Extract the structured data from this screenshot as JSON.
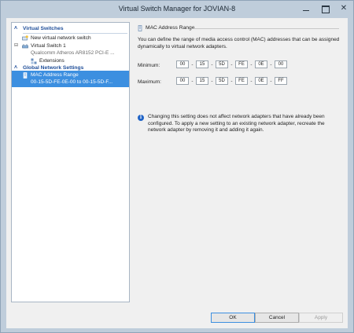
{
  "window": {
    "title": "Virtual Switch Manager for JOVIAN-8",
    "minimize_glyph": "",
    "maximize_glyph": "",
    "close_glyph": "✕"
  },
  "tree": {
    "virtual_switches": {
      "header": "Virtual Switches",
      "items": [
        {
          "label": "New virtual network switch",
          "icon": "new-switch-icon"
        },
        {
          "label": "Virtual Switch 1",
          "sublabel": "Qualcomm Atheros AR8152 PCI-E ...",
          "icon": "network-switch-icon"
        },
        {
          "label": "Extensions",
          "icon": "extensions-icon"
        }
      ]
    },
    "global_network_settings": {
      "header": "Global Network Settings",
      "items": [
        {
          "label": "MAC Address Range",
          "sublabel": "00-15-5D-FE-0E-00 to 00-15-5D-F...",
          "icon": "mac-range-icon",
          "selected": true
        }
      ]
    }
  },
  "detail": {
    "group_title": "MAC Address Range",
    "description": "You can define the range of media access control (MAC) addresses that can be assigned dynamically to virtual network adapters.",
    "minimum": {
      "label": "Minimum:",
      "octets": [
        "00",
        "15",
        "5D",
        "FE",
        "0E",
        "00"
      ]
    },
    "maximum": {
      "label": "Maximum:",
      "octets": [
        "00",
        "15",
        "5D",
        "FE",
        "0E",
        "FF"
      ]
    },
    "info_glyph": "i",
    "info_text": "Changing this setting does not affect network adapters that have already been configured.  To apply a new setting to an existing network adapter, recreate the network adapter by removing it and adding it again."
  },
  "footer": {
    "ok_label": "OK",
    "cancel_label": "Cancel",
    "apply_label": "Apply"
  },
  "colors": {
    "selection": "#3c8fe0",
    "section_header": "#1f4e99",
    "title_bar": "#bfcddb"
  }
}
